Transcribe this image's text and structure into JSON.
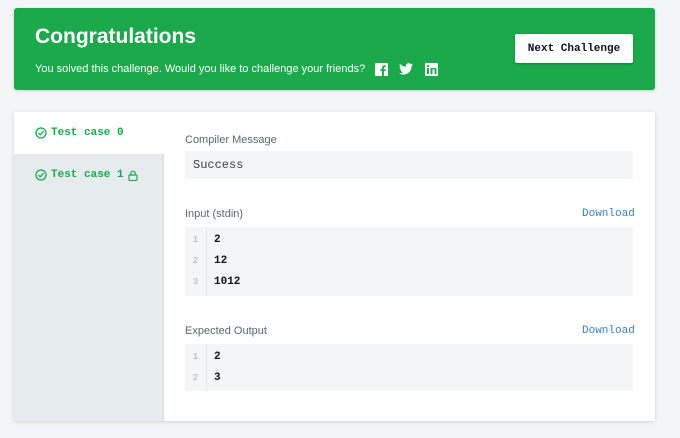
{
  "banner": {
    "title": "Congratulations",
    "subtitle": "You solved this challenge. Would you like to challenge your friends?",
    "social_icons": [
      "facebook-icon",
      "twitter-icon",
      "linkedin-icon"
    ],
    "next_button": "Next Challenge",
    "color": "#1ba94c"
  },
  "tabs": [
    {
      "label": "Test case 0",
      "status": "passed",
      "active": true
    },
    {
      "label": "Test case 1",
      "status": "passed",
      "locked": true
    }
  ],
  "compiler": {
    "label": "Compiler Message",
    "message": "Success"
  },
  "input": {
    "label": "Input (stdin)",
    "download": "Download",
    "lines": [
      {
        "num": "1",
        "text": "2"
      },
      {
        "num": "2",
        "text": "12"
      },
      {
        "num": "3",
        "text": "1012"
      }
    ]
  },
  "expected": {
    "label": "Expected Output",
    "download": "Download",
    "lines": [
      {
        "num": "1",
        "text": "2"
      },
      {
        "num": "2",
        "text": "3"
      }
    ]
  },
  "colors": {
    "success_green": "#1ba94c",
    "link_blue": "#3a7fc0"
  }
}
